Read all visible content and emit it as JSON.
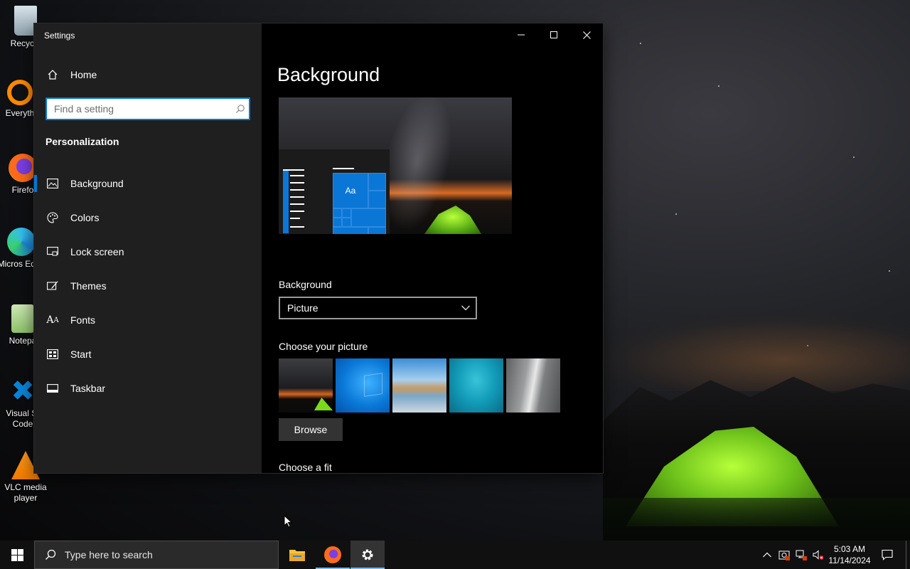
{
  "desktop": {
    "icons": [
      {
        "label": "Recycle",
        "icon": "recycle-bin-icon"
      },
      {
        "label": "Everyth",
        "icon": "everything-icon"
      },
      {
        "label": "Firefo",
        "icon": "firefox-icon"
      },
      {
        "label": "Micros Edge",
        "icon": "edge-icon"
      },
      {
        "label": "Notepa",
        "icon": "notepad-icon"
      },
      {
        "label": "Visual St Code",
        "icon": "vscode-icon"
      },
      {
        "label": "VLC media player",
        "icon": "vlc-icon"
      }
    ]
  },
  "window": {
    "title": "Settings",
    "controls": {
      "minimize": "minimize-icon",
      "maximize": "maximize-icon",
      "close": "close-icon"
    }
  },
  "sidebar": {
    "home_label": "Home",
    "search_placeholder": "Find a setting",
    "section_title": "Personalization",
    "items": [
      {
        "label": "Background",
        "icon": "picture-icon",
        "active": true
      },
      {
        "label": "Colors",
        "icon": "palette-icon"
      },
      {
        "label": "Lock screen",
        "icon": "lock-screen-icon"
      },
      {
        "label": "Themes",
        "icon": "brush-icon"
      },
      {
        "label": "Fonts",
        "icon": "font-icon"
      },
      {
        "label": "Start",
        "icon": "start-icon"
      },
      {
        "label": "Taskbar",
        "icon": "taskbar-icon"
      }
    ]
  },
  "main": {
    "heading": "Background",
    "preview_tile_text": "Aa",
    "background_label": "Background",
    "background_select": "Picture",
    "choose_picture_label": "Choose your picture",
    "thumbnails": [
      "wallpaper-tent",
      "wallpaper-windows",
      "wallpaper-beach",
      "wallpaper-underwater",
      "wallpaper-waterfall"
    ],
    "browse_label": "Browse",
    "choose_fit_label": "Choose a fit"
  },
  "taskbar": {
    "search_placeholder": "Type here to search",
    "pinned": [
      "file-explorer-icon",
      "firefox-icon",
      "settings-gear-icon"
    ],
    "clock_time": "5:03 AM",
    "clock_date": "11/14/2024"
  }
}
